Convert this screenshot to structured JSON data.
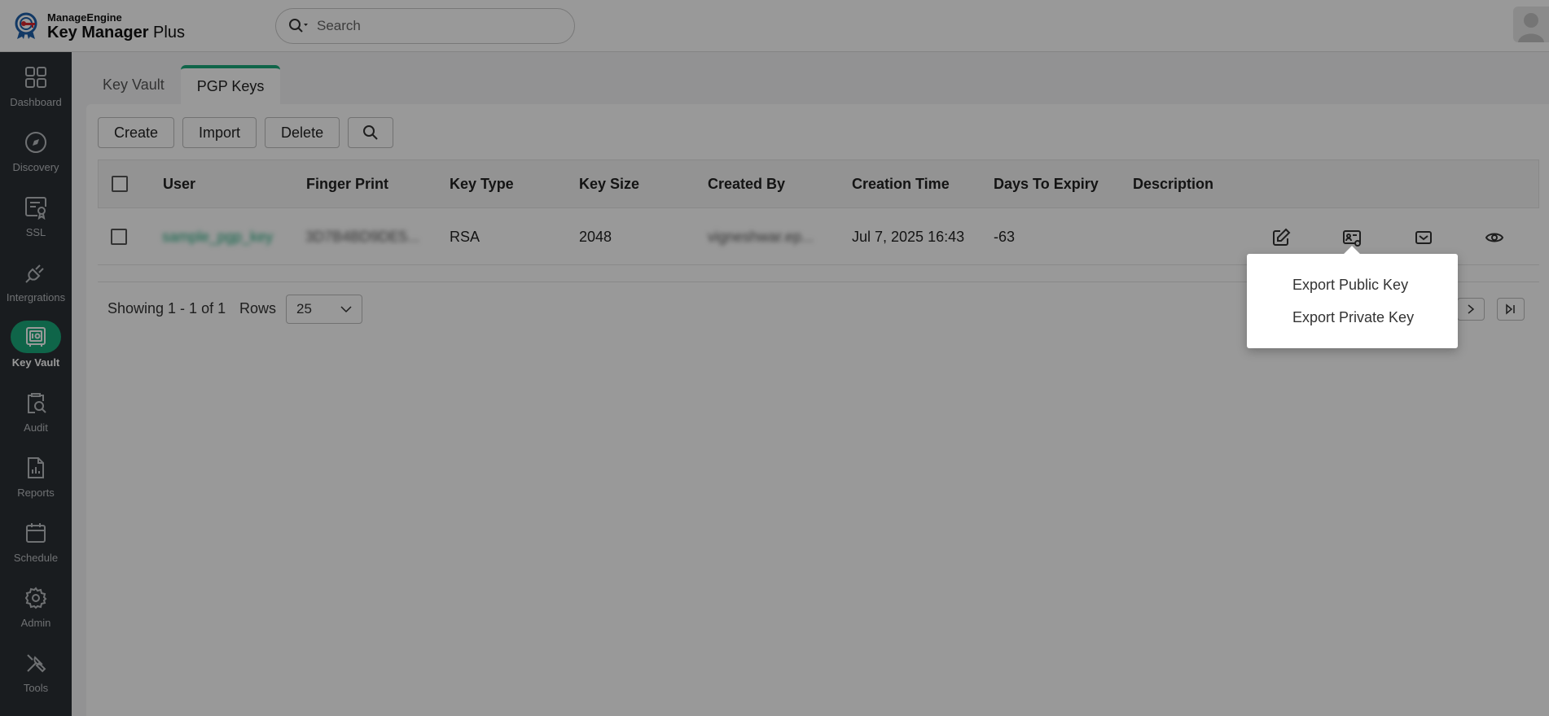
{
  "app": {
    "brand": "ManageEngine",
    "product_bold": "Key Manager",
    "product_rest": " Plus",
    "accent_color": "#1aa97a"
  },
  "search": {
    "placeholder": "Search"
  },
  "sidebar": {
    "items": [
      {
        "label": "Dashboard",
        "icon": "dashboard-icon"
      },
      {
        "label": "Discovery",
        "icon": "compass-icon"
      },
      {
        "label": "SSL",
        "icon": "certificate-icon"
      },
      {
        "label": "Intergrations",
        "icon": "plug-icon"
      },
      {
        "label": "Key Vault",
        "icon": "vault-icon",
        "active": true
      },
      {
        "label": "Audit",
        "icon": "audit-icon"
      },
      {
        "label": "Reports",
        "icon": "reports-icon"
      },
      {
        "label": "Schedule",
        "icon": "calendar-icon"
      },
      {
        "label": "Admin",
        "icon": "gear-icon"
      },
      {
        "label": "Tools",
        "icon": "tools-icon"
      }
    ]
  },
  "tabs": [
    {
      "label": "Key Vault",
      "active": false
    },
    {
      "label": "PGP Keys",
      "active": true
    }
  ],
  "toolbar": {
    "create_label": "Create",
    "import_label": "Import",
    "delete_label": "Delete"
  },
  "table": {
    "columns": [
      "User",
      "Finger Print",
      "Key Type",
      "Key Size",
      "Created By",
      "Creation Time",
      "Days To Expiry",
      "Description"
    ],
    "rows": [
      {
        "user": "sample_pgp_key",
        "finger_print": "3D7B4BD9DE5...",
        "key_type": "RSA",
        "key_size": "2048",
        "created_by": "vigneshwar.ep...",
        "creation_time": "Jul 7, 2025 16:43",
        "days_to_expiry": "-63",
        "description": ""
      }
    ]
  },
  "footer": {
    "showing": "Showing 1 - 1 of 1",
    "rows_label": "Rows",
    "rows_value": "25"
  },
  "export_menu": {
    "items": [
      "Export Public Key",
      "Export Private Key"
    ]
  }
}
